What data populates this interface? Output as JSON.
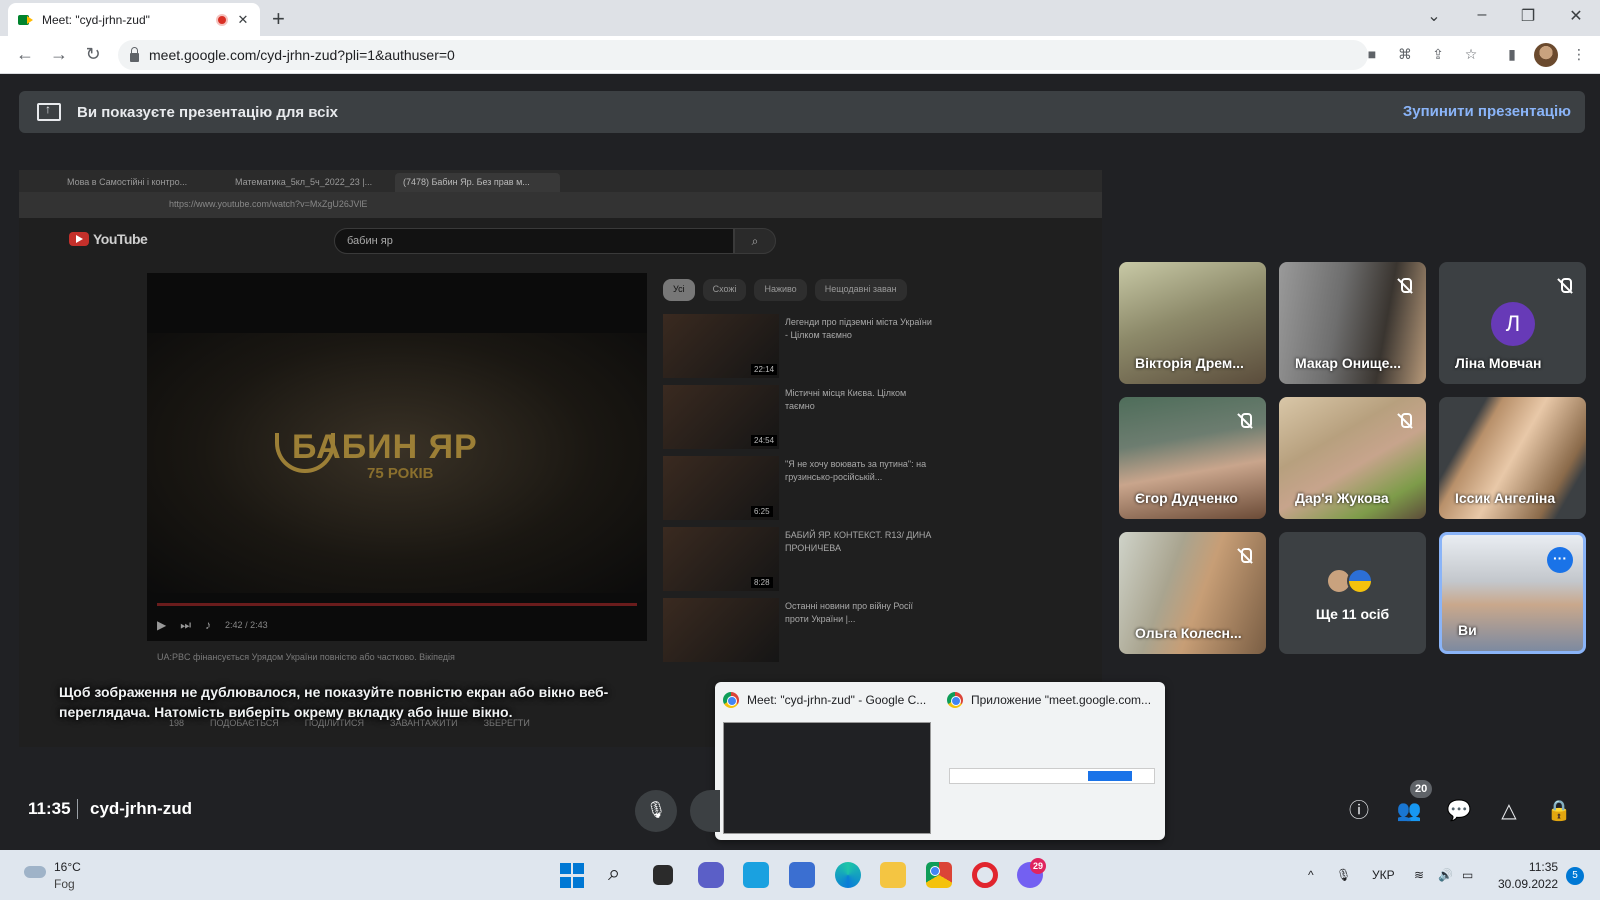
{
  "browser": {
    "tab_title": "Meet: \"cyd-jrhn-zud\"",
    "tab_close": "✕",
    "new_tab": "+",
    "url": "meet.google.com/cyd-jrhn-zud?pli=1&authuser=0"
  },
  "banner": {
    "text": "Ви показуєте презентацію для всіх",
    "stop": "Зупинити презентацію"
  },
  "shared_screen": {
    "tabs": [
      "Мова в Самостійні і контро...",
      "Математика_5кл_5ч_2022_23 |...",
      "(7478) Бабин Яр. Без прав м..."
    ],
    "url": "https://www.youtube.com/watch?v=MxZgU26JVlE",
    "yt_logo": "YouTube",
    "search": "бабин яр",
    "video_title": "БАБИН ЯР",
    "video_subtitle": "75 РОКІВ",
    "time": "2:42 / 2:43",
    "chips": [
      "Усі",
      "Схожі",
      "Наживо",
      "Нещодавні заван"
    ],
    "recs": [
      {
        "title": "Легенди про підземні міста України - Цілком таємно",
        "dur": "22:14"
      },
      {
        "title": "Містичні місця Києва. Цілком таємно",
        "dur": "24:54"
      },
      {
        "title": "\"Я не хочу воювать за путина\": на грузинсько-російській...",
        "dur": "6:25"
      },
      {
        "title": "БАБИЙ ЯР. КОНТЕКСТ. R13/ ДИНА ПРОНИЧЕВА",
        "dur": "8:28"
      },
      {
        "title": "Останні новини про війну Росії проти України |...",
        "dur": ""
      }
    ],
    "ad_note": "UA:PBC фінансується Урядом України повністю або частково. Вікіпедія",
    "under": [
      "198",
      "ПОДОБАЄТЬСЯ",
      "ПОДІЛИТИСЯ",
      "ЗАВАНТАЖИТИ",
      "ЗБЕРЕГТИ"
    ],
    "warning": "Щоб зображення не дублювалося, не показуйте повністю екран або вікно веб-переглядача. Натомість виберіть окрему вкладку або інше вікно."
  },
  "participants": [
    {
      "name": "Вікторія Дрем..."
    },
    {
      "name": "Макар Онище..."
    },
    {
      "name": "Ліна Мовчан",
      "initial": "Л"
    },
    {
      "name": "Єгор Дудченко"
    },
    {
      "name": "Дар'я Жукова"
    },
    {
      "name": "Іссик Ангеліна"
    },
    {
      "name": "Ольга Колесн..."
    },
    {
      "name": "Ще 11 осіб"
    },
    {
      "name": "Ви"
    }
  ],
  "picker": {
    "item1": "Meet: \"cyd-jrhn-zud\" - Google C...",
    "item2": "Приложение \"meet.google.com..."
  },
  "meet_bar": {
    "time": "11:35",
    "code": "cyd-jrhn-zud",
    "people_count": "20"
  },
  "taskbar": {
    "temp": "16°C",
    "condition": "Fog",
    "lang": "УКР",
    "time": "11:35",
    "date": "30.09.2022",
    "viber_badge": "29",
    "notif_count": "5"
  },
  "colors": {
    "meet_bg": "#202124",
    "accent_blue": "#8ab4f8",
    "avatar_purple": "#673ab7"
  }
}
